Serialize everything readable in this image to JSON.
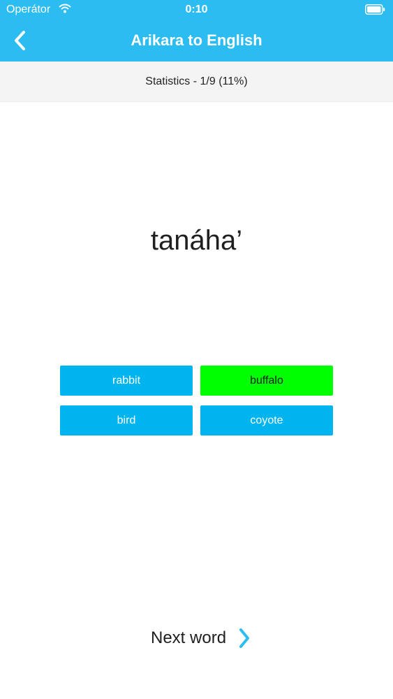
{
  "status_bar": {
    "carrier": "Operátor",
    "time": "0:10"
  },
  "nav": {
    "title": "Arikara to English"
  },
  "stats": {
    "text": "Statistics - 1/9 (11%)"
  },
  "word": "tanáha’",
  "options": [
    {
      "label": "rabbit",
      "state": "default"
    },
    {
      "label": "buffalo",
      "state": "correct"
    },
    {
      "label": "bird",
      "state": "default"
    },
    {
      "label": "coyote",
      "state": "default"
    }
  ],
  "next": {
    "label": "Next word"
  },
  "colors": {
    "header": "#2bbcf2",
    "option": "#00b4ef",
    "correct": "#00ff00",
    "chevron": "#2bbcf2"
  }
}
